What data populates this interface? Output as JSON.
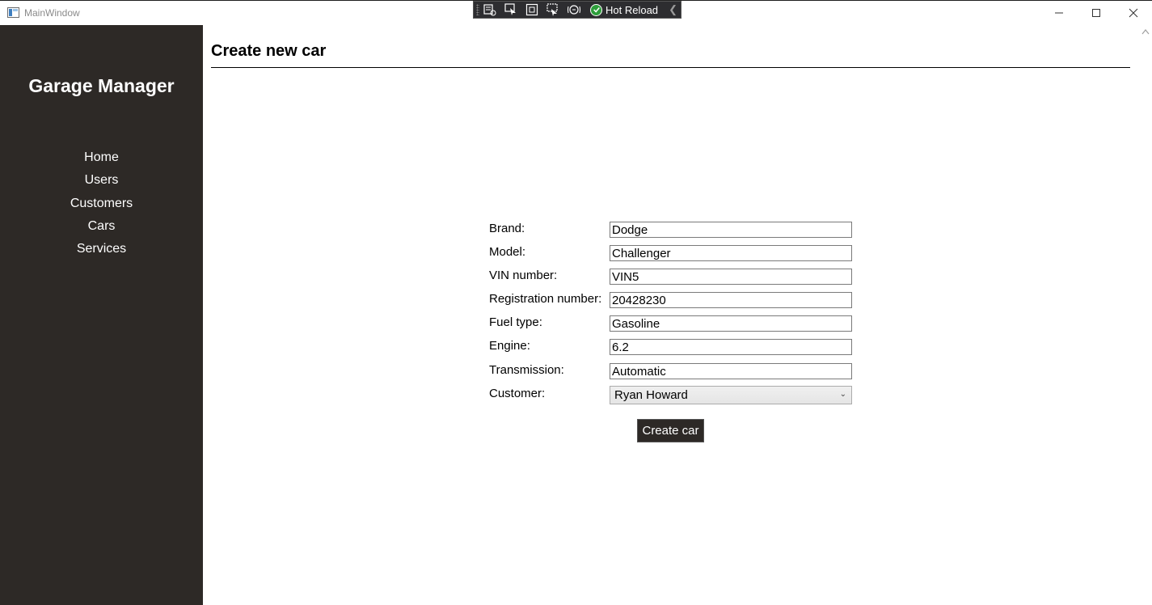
{
  "window": {
    "title": "MainWindow",
    "hot_reload_label": "Hot Reload",
    "minimize_icon": "minimize-icon",
    "maximize_icon": "maximize-icon",
    "close_icon": "close-icon"
  },
  "sidebar": {
    "brand": "Garage Manager",
    "items": [
      {
        "label": "Home"
      },
      {
        "label": "Users"
      },
      {
        "label": "Customers"
      },
      {
        "label": "Cars"
      },
      {
        "label": "Services"
      }
    ],
    "background": "#2d2926"
  },
  "main": {
    "title": "Create new car",
    "form": {
      "brand": {
        "label": "Brand:",
        "value": "Dodge"
      },
      "model": {
        "label": "Model:",
        "value": "Challenger"
      },
      "vin": {
        "label": "VIN number:",
        "value": "VIN5"
      },
      "registration": {
        "label": "Registration number:",
        "value": "20428230"
      },
      "fuel": {
        "label": "Fuel type:",
        "value": "Gasoline"
      },
      "engine": {
        "label": "Engine:",
        "value": "6.2"
      },
      "transmission": {
        "label": "Transmission:",
        "value": "Automatic"
      },
      "customer": {
        "label": "Customer:",
        "selected": "Ryan Howard"
      }
    },
    "submit_label": "Create car"
  }
}
